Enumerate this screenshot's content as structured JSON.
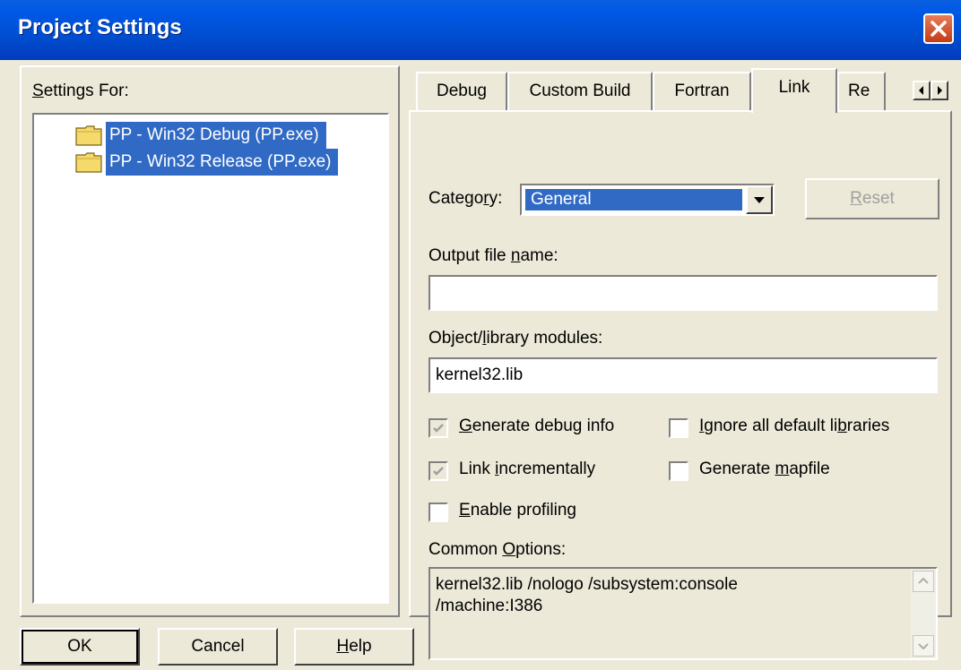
{
  "window": {
    "title": "Project Settings"
  },
  "left": {
    "settings_for_label": "Settings For:",
    "tree_items": [
      {
        "label": "PP - Win32 Debug (PP.exe)"
      },
      {
        "label": "PP - Win32 Release (PP.exe)"
      }
    ]
  },
  "tabs": {
    "items": [
      {
        "label": "Debug"
      },
      {
        "label": "Custom Build"
      },
      {
        "label": "Fortran"
      },
      {
        "label": "Link"
      },
      {
        "label": "Re"
      }
    ],
    "active": "Link"
  },
  "link": {
    "category_label": "Category:",
    "category_value": "General",
    "reset_label": "Reset",
    "output_file_label": "Output file name:",
    "output_file_value": "",
    "modules_label": "Object/library modules:",
    "modules_value": "kernel32.lib",
    "checkboxes": {
      "generate_debug_info": {
        "label": "Generate debug info",
        "checked": true,
        "enabled": false
      },
      "link_incrementally": {
        "label": "Link incrementally",
        "checked": true,
        "enabled": false
      },
      "enable_profiling": {
        "label": "Enable profiling",
        "checked": false,
        "enabled": true
      },
      "ignore_default_libs": {
        "label": "Ignore all default libraries",
        "checked": false,
        "enabled": true
      },
      "generate_mapfile": {
        "label": "Generate mapfile",
        "checked": false,
        "enabled": true
      }
    },
    "common_options_label": "Common Options:",
    "common_options_line1": "kernel32.lib /nologo /subsystem:console",
    "common_options_line2": "/machine:I386"
  },
  "buttons": {
    "ok": "OK",
    "cancel": "Cancel",
    "help": "Help"
  },
  "colors": {
    "titlebar": "#0058e6",
    "selection": "#316ac5",
    "face": "#ece9d8"
  }
}
